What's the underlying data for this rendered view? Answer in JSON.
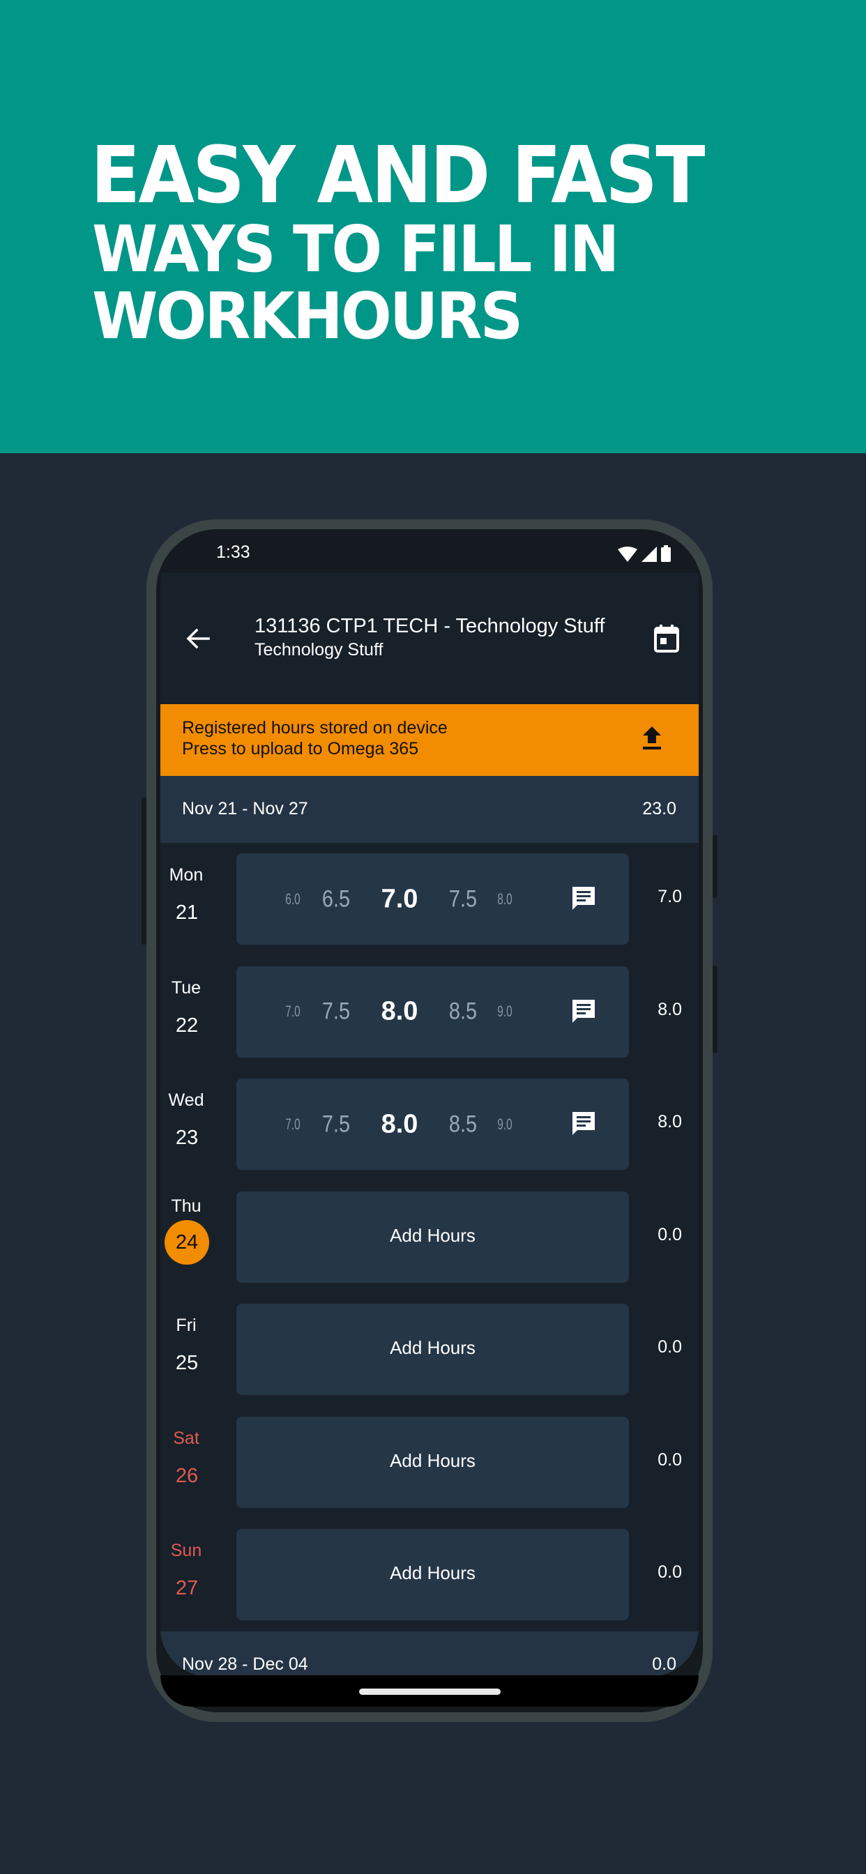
{
  "hero": {
    "line1": "EASY AND FAST",
    "line2": "WAYS TO FILL IN",
    "line3": "WORKHOURS"
  },
  "status_bar": {
    "time": "1:33",
    "icons": [
      "wifi-icon",
      "signal-icon",
      "battery-icon"
    ]
  },
  "app_bar": {
    "back_icon": "arrow-left-icon",
    "title": "131136 CTP1 TECH - Technology Stuff",
    "subtitle": "Technology Stuff",
    "calendar_icon": "calendar-today-icon"
  },
  "banner": {
    "line1": "Registered hours stored on device",
    "line2": "Press to upload to Omega 365",
    "icon": "upload-icon",
    "color": "#f28c00"
  },
  "weeks": [
    {
      "range": "Nov 21 - Nov 27",
      "total": "23.0",
      "days": [
        {
          "name": "Mon",
          "num": "21",
          "type": "picker",
          "picker": [
            "6.0",
            "6.5",
            "7.0",
            "7.5",
            "8.0"
          ],
          "total": "7.0"
        },
        {
          "name": "Tue",
          "num": "22",
          "type": "picker",
          "picker": [
            "7.0",
            "7.5",
            "8.0",
            "8.5",
            "9.0"
          ],
          "total": "8.0"
        },
        {
          "name": "Wed",
          "num": "23",
          "type": "picker",
          "picker": [
            "7.0",
            "7.5",
            "8.0",
            "8.5",
            "9.0"
          ],
          "total": "8.0"
        },
        {
          "name": "Thu",
          "num": "24",
          "type": "add",
          "add_label": "Add Hours",
          "total": "0.0",
          "today": true
        },
        {
          "name": "Fri",
          "num": "25",
          "type": "add",
          "add_label": "Add Hours",
          "total": "0.0"
        },
        {
          "name": "Sat",
          "num": "26",
          "type": "add",
          "add_label": "Add Hours",
          "total": "0.0",
          "weekend": true
        },
        {
          "name": "Sun",
          "num": "27",
          "type": "add",
          "add_label": "Add Hours",
          "total": "0.0",
          "weekend": true
        }
      ]
    },
    {
      "range": "Nov 28 - Dec 04",
      "total": "0.0"
    }
  ],
  "colors": {
    "hero_bg": "#009688",
    "page_bg": "#1f2a36",
    "accent": "#f28c00",
    "weekend": "#e05a52",
    "card_bg": "#253647"
  }
}
